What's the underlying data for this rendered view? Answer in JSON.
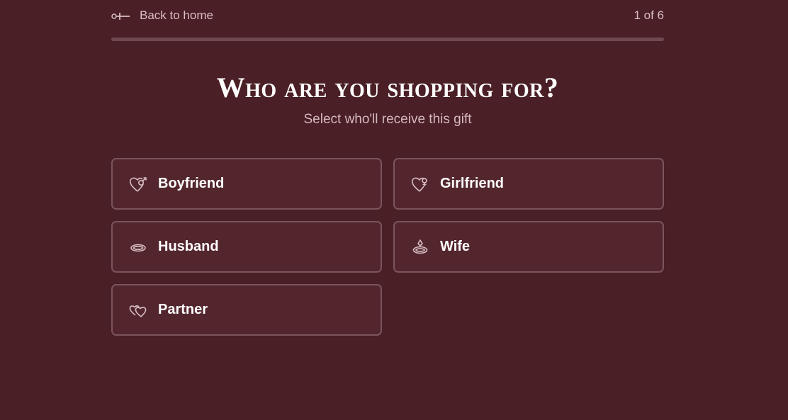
{
  "header": {
    "back_label": "Back to home",
    "step_text": "1 of 6",
    "progress": 0.0
  },
  "page": {
    "title": "Who are you shopping for?",
    "subtitle": "Select who'll receive this gift"
  },
  "options": [
    {
      "label": "Boyfriend",
      "icon": "heart-male-icon"
    },
    {
      "label": "Girlfriend",
      "icon": "heart-female-icon"
    },
    {
      "label": "Husband",
      "icon": "ring-icon"
    },
    {
      "label": "Wife",
      "icon": "diamond-ring-icon"
    },
    {
      "label": "Partner",
      "icon": "two-hearts-icon"
    }
  ],
  "colors": {
    "background": "#4a1f25",
    "card": "#53262d",
    "card_border": "#7a555b",
    "icon": "#d9bfc3"
  }
}
